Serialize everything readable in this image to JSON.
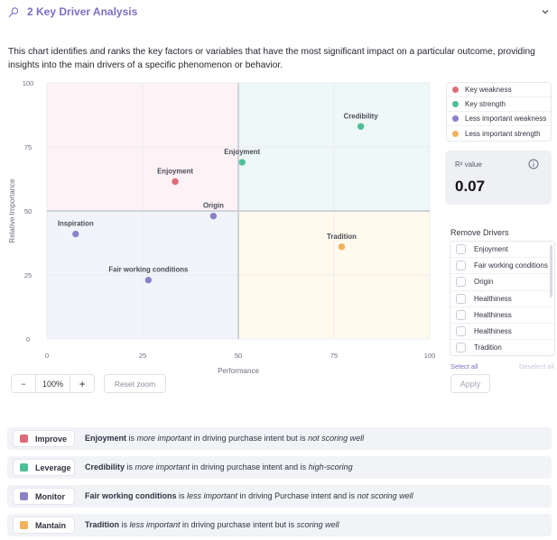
{
  "header": {
    "icon": "pin-icon",
    "title": "2  Key Driver Analysis",
    "collapse_icon": "chevron-down-icon"
  },
  "description": "This chart identifies and ranks the key factors or variables that have the most significant impact on a particular outcome, providing insights into the main drivers of a specific phenomenon or behavior.",
  "colors": {
    "key_weakness": "#e06b78",
    "key_strength": "#4dbf99",
    "less_important_weakness": "#8a82c9",
    "less_important_strength": "#f2b25c",
    "accent": "#7b6fc4"
  },
  "legend": [
    {
      "label": "Key weakness",
      "color": "#e06b78"
    },
    {
      "label": "Key strength",
      "color": "#4dbf99"
    },
    {
      "label": "Less important weakness",
      "color": "#8a82c9"
    },
    {
      "label": "Less important strength",
      "color": "#f2b25c"
    }
  ],
  "r2": {
    "label": "R² value",
    "value": "0.07",
    "info_icon": "info-icon"
  },
  "remove_drivers": {
    "title": "Remove Drivers",
    "items": [
      "Enjoyment",
      "Fair working conditions",
      "Origin",
      "Healthiness",
      "Healthiness",
      "Healthiness",
      "Tradition"
    ],
    "select_all": "Select all",
    "deselect_all": "Deselect all",
    "apply": "Apply"
  },
  "zoom": {
    "minus": "−",
    "value": "100%",
    "plus": "+",
    "reset": "Reset zoom"
  },
  "chart_data": {
    "type": "scatter",
    "xlabel": "Performance",
    "ylabel": "Relative Importance",
    "xlim": [
      0,
      100
    ],
    "ylim": [
      0,
      100
    ],
    "xticks": [
      0,
      25,
      50,
      75,
      100
    ],
    "yticks": [
      0,
      25,
      50,
      75,
      100
    ],
    "grid": true,
    "quadrant_threshold": {
      "x": 50,
      "y": 50
    },
    "quadrants": [
      {
        "name": "Key weakness",
        "position": "top-left",
        "color": "#fdf2f5"
      },
      {
        "name": "Key strength",
        "position": "top-right",
        "color": "#eef8f6"
      },
      {
        "name": "Less important weakness",
        "position": "bottom-left",
        "color": "#f3f4fa"
      },
      {
        "name": "Less important strength",
        "position": "bottom-right",
        "color": "#fefaee"
      }
    ],
    "legend_position": "right",
    "points": [
      {
        "label": "Credibility",
        "x": 82,
        "y": 83,
        "category": "Key strength",
        "color": "#4dbf99"
      },
      {
        "label": "Enjoyment",
        "x": 51,
        "y": 69,
        "category": "Key strength",
        "color": "#4dbf99"
      },
      {
        "label": "Enjoyment",
        "x": 33.5,
        "y": 61.5,
        "category": "Key weakness",
        "color": "#e06b78"
      },
      {
        "label": "Origin",
        "x": 43.5,
        "y": 48,
        "category": "Less important weakness",
        "color": "#8a82c9"
      },
      {
        "label": "Inspiration",
        "x": 7.5,
        "y": 41,
        "category": "Less important weakness",
        "color": "#8a82c9"
      },
      {
        "label": "Fair working conditions",
        "x": 26.5,
        "y": 23,
        "category": "Less important weakness",
        "color": "#8a82c9"
      },
      {
        "label": "Tradition",
        "x": 77,
        "y": 36,
        "category": "Less important strength",
        "color": "#f2b25c"
      }
    ]
  },
  "summary": [
    {
      "tag": "Improve",
      "color": "#e06b78",
      "driver": "Enjoyment",
      "t1": " is ",
      "em1": "more important",
      "t2": " in driving purchase intent but is ",
      "em2": "not scoring well"
    },
    {
      "tag": "Leverage",
      "color": "#4dbf99",
      "driver": "Credibility",
      "t1": " is ",
      "em1": "more important",
      "t2": " in driving purchase intent and is ",
      "em2": "high-scoring"
    },
    {
      "tag": "Monitor",
      "color": "#8a82c9",
      "driver": "Fair working conditions",
      "t1": " is ",
      "em1": "less important",
      "t2": " in driving Purchase intent and is ",
      "em2": "not scoring well"
    },
    {
      "tag": "Mantain",
      "color": "#f2b25c",
      "driver": "Tradition",
      "t1": " is ",
      "em1": "less important",
      "t2": " in driving purchase intent but is ",
      "em2": "scoring well"
    }
  ]
}
